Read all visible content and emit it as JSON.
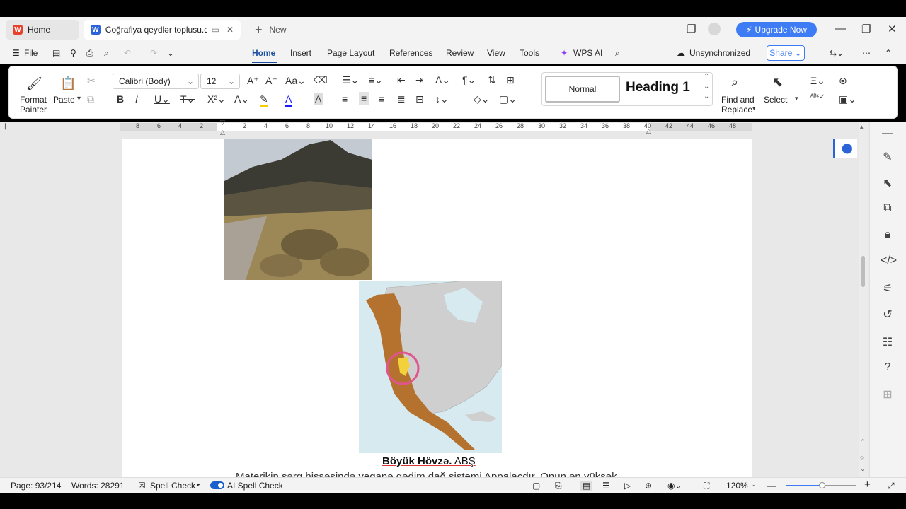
{
  "titlebar": {
    "home_tab": "Home",
    "doc_tab": "Coğrafiya qeydlər toplusu.doc",
    "new_tab": "New",
    "upgrade": "Upgrade Now"
  },
  "menu": {
    "file": "File",
    "items": [
      "Home",
      "Insert",
      "Page Layout",
      "References",
      "Review",
      "View",
      "Tools"
    ],
    "wps_ai": "WPS AI",
    "sync_status": "Unsynchronized",
    "share": "Share"
  },
  "ribbon": {
    "format_painter_1": "Format",
    "format_painter_2": "Painter",
    "paste": "Paste",
    "font_name": "Calibri (Body)",
    "font_size": "12",
    "style_normal": "Normal",
    "style_heading": "Heading 1",
    "find_replace_1": "Find and",
    "find_replace_2": "Replace",
    "select": "Select"
  },
  "ruler": {
    "left_numbers": [
      "8",
      "6",
      "4",
      "2"
    ],
    "right_numbers": [
      "2",
      "4",
      "6",
      "8",
      "10",
      "12",
      "14",
      "16",
      "18",
      "20",
      "22",
      "24",
      "26",
      "28",
      "30",
      "32",
      "34",
      "36",
      "38",
      "40",
      "42",
      "44",
      "46",
      "48"
    ]
  },
  "document": {
    "caption_bold": "Böyük Hövzə.",
    "caption_rest": " ABŞ",
    "cut_line": "Materikin şərq hissəsində yeganə qədim dağ sistemi Appalaçdır. Onun ən yüksək"
  },
  "status": {
    "page": "Page: 93/214",
    "words": "Words: 28291",
    "spell": "Spell Check",
    "ai_spell": "AI Spell Check",
    "zoom": "120%"
  },
  "colors": {
    "accent": "#1a4fa0",
    "upgrade": "#3d7cf5",
    "map_land": "#b5722f",
    "map_sea": "#d7eaf0"
  }
}
